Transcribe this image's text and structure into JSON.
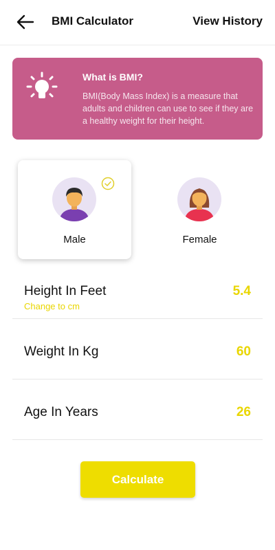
{
  "header": {
    "back_icon": "arrow-left-icon",
    "title": "BMI Calculator",
    "view_history_label": "View History"
  },
  "info_card": {
    "icon": "lightbulb-icon",
    "title": "What is BMI?",
    "text": "BMI(Body Mass Index) is a measure that adults and children can use to see if they are a healthy weight for their height.",
    "background": "#c65c8a"
  },
  "gender": {
    "selected": "Male",
    "options": [
      {
        "label": "Male",
        "icon": "male-avatar-icon",
        "selected": true
      },
      {
        "label": "Female",
        "icon": "female-avatar-icon",
        "selected": false
      }
    ]
  },
  "fields": {
    "height": {
      "label": "Height In Feet",
      "value": "5.4",
      "switch_unit_label": "Change to cm"
    },
    "weight": {
      "label": "Weight In Kg",
      "value": "60"
    },
    "age": {
      "label": "Age In Years",
      "value": "26"
    }
  },
  "calculate_label": "Calculate",
  "colors": {
    "accent": "#e9d600",
    "button": "#eedd00",
    "card": "#c65c8a"
  }
}
